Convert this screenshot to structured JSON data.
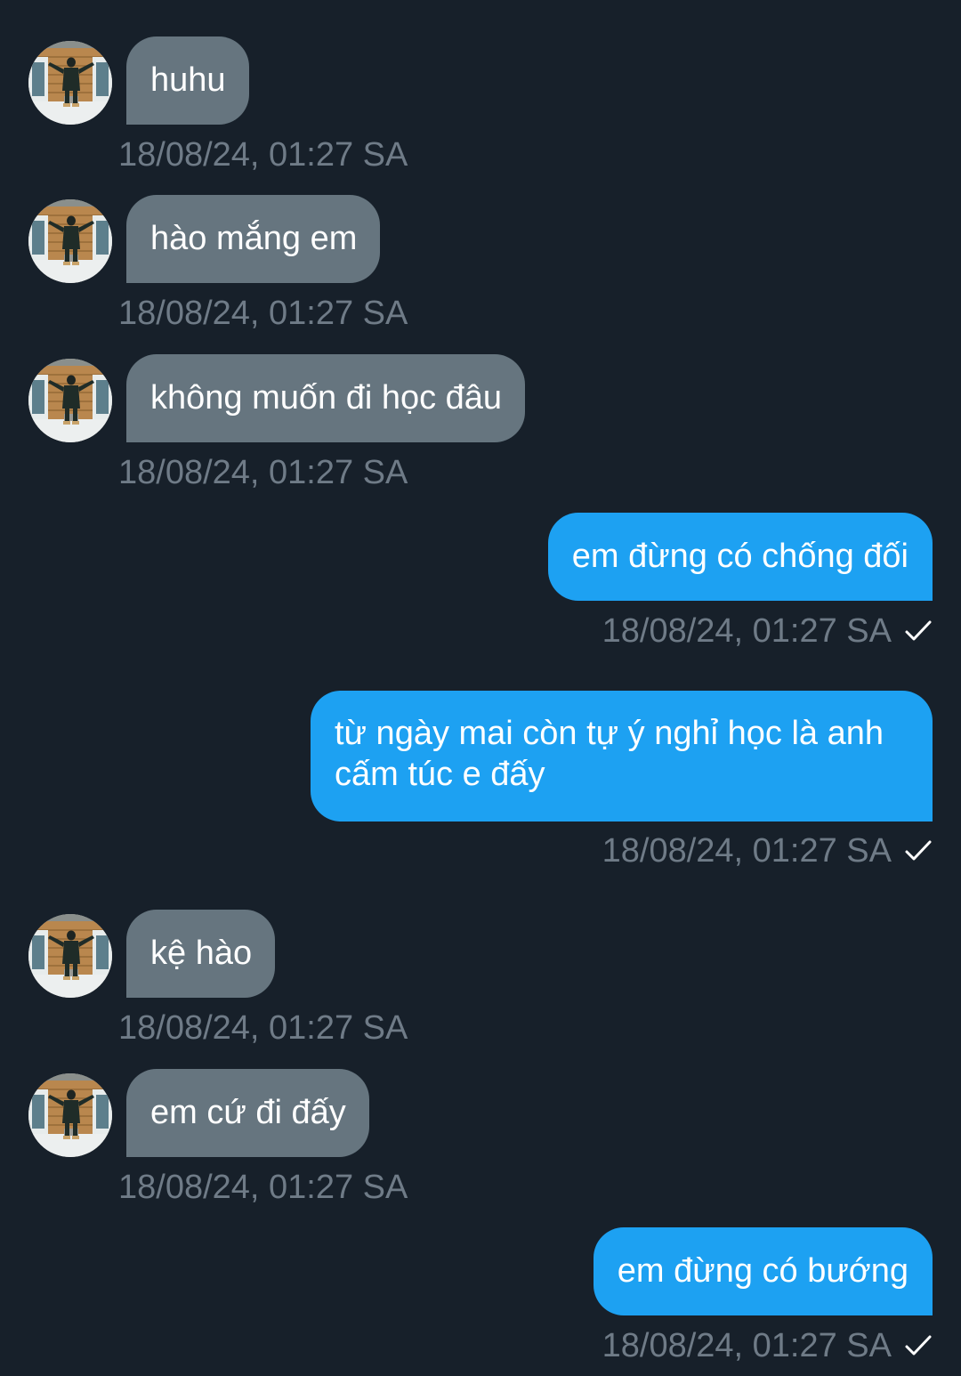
{
  "conversation": {
    "messages": [
      {
        "direction": "incoming",
        "text": "huhu",
        "timestamp": "18/08/24, 01:27 SA"
      },
      {
        "direction": "incoming",
        "text": "hào mắng em",
        "timestamp": "18/08/24, 01:27 SA"
      },
      {
        "direction": "incoming",
        "text": "không muốn đi học đâu",
        "timestamp": "18/08/24, 01:27 SA"
      },
      {
        "direction": "outgoing",
        "text": "em đừng có chống đối",
        "timestamp": "18/08/24, 01:27 SA",
        "status_icon": "check-icon"
      },
      {
        "direction": "outgoing",
        "text": "từ ngày mai còn tự ý nghỉ học là anh cấm túc e đấy",
        "timestamp": "18/08/24, 01:27 SA",
        "status_icon": "check-icon"
      },
      {
        "direction": "incoming",
        "text": "kệ hào",
        "timestamp": "18/08/24, 01:27 SA"
      },
      {
        "direction": "incoming",
        "text": "em cứ đi đấy",
        "timestamp": "18/08/24, 01:27 SA"
      },
      {
        "direction": "outgoing",
        "text": "em đừng có bướng",
        "timestamp": "18/08/24, 01:27 SA",
        "status_icon": "check-icon"
      }
    ]
  },
  "colors": {
    "background": "#17202a",
    "incoming_bubble": "#66757f",
    "outgoing_bubble": "#1da1f2",
    "message_text": "#ffffff",
    "timestamp_text": "#6f7b87"
  }
}
